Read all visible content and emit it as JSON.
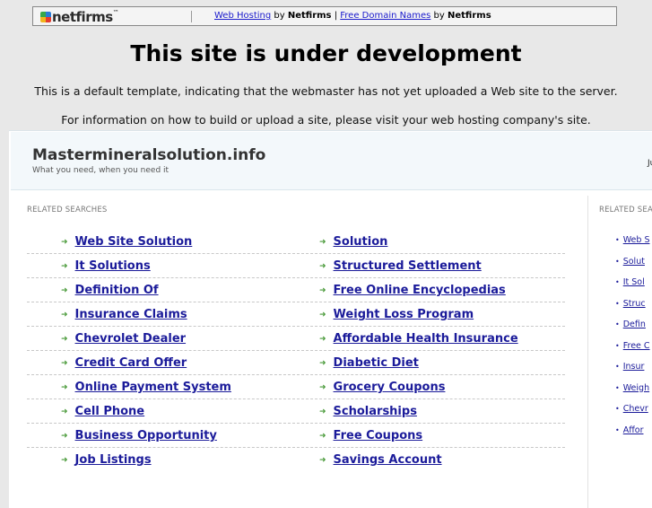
{
  "banner": {
    "logo": "netfirms",
    "link1": "Web Hosting",
    "by1": "by",
    "brand1": "Netfirms",
    "pipe": "|",
    "link2": "Free Domain Names",
    "by2": "by",
    "brand2": "Netfirms"
  },
  "heading": "This site is under development",
  "message1": "This is a default template, indicating that the webmaster has not yet uploaded a Web site to the server.",
  "message2": "For information on how to build or upload a site, please visit your web hosting company's site.",
  "parked": {
    "site_title": "Mastermineralsolution.info",
    "tagline": "What you need, when you need it",
    "corner_text": "Ju",
    "related_label": "RELATED SEARCHES",
    "side_label": "RELATED SEA",
    "rows": [
      [
        "Web Site Solution",
        "Solution"
      ],
      [
        "It Solutions",
        "Structured Settlement"
      ],
      [
        "Definition Of",
        "Free Online Encyclopedias"
      ],
      [
        "Insurance Claims",
        "Weight Loss Program"
      ],
      [
        "Chevrolet Dealer",
        "Affordable Health Insurance"
      ],
      [
        "Credit Card Offer",
        "Diabetic Diet"
      ],
      [
        "Online Payment System",
        "Grocery Coupons"
      ],
      [
        "Cell Phone",
        "Scholarships"
      ],
      [
        "Business Opportunity",
        "Free Coupons"
      ],
      [
        "Job Listings",
        "Savings Account"
      ]
    ],
    "side_links": [
      "Web S",
      "Solut",
      "It Sol",
      "Struc",
      "Defin",
      "Free C",
      "Insur",
      "Weigh",
      "Chevr",
      "Affor"
    ]
  },
  "colors": {
    "link": "#1b1b9a",
    "arrow": "#4a9a3a",
    "topbar": "#f3f8fb"
  }
}
